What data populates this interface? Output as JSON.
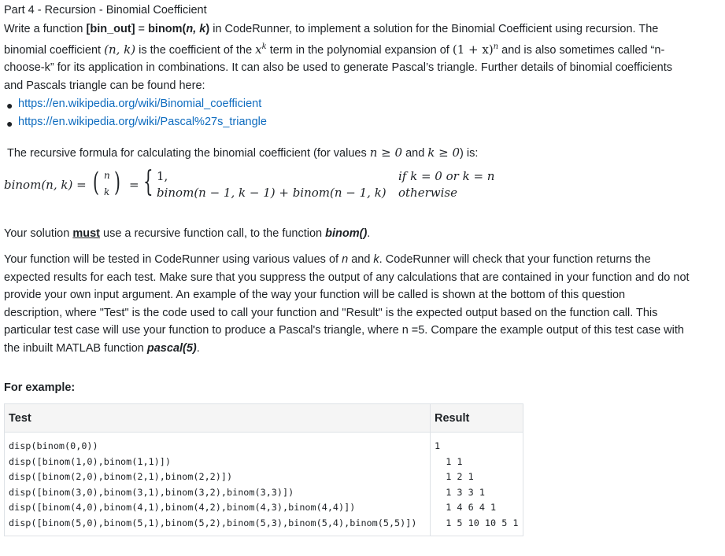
{
  "heading": "Part 4 - Recursion - Binomial Coefficient",
  "intro": {
    "t1": "Write a function ",
    "b1": "[bin_out]",
    "t2": " = ",
    "b2": "binom(",
    "b2i": "n, k",
    "b2e": ")",
    "t3": " in CodeRunner, to implement a solution for the Binomial Coefficient using recursion.  The",
    "line2a": "binomial coefficient ",
    "m_nk": "(n, k)",
    "line2b": " is the coefficient of the ",
    "m_xk": "x",
    "m_xk_sup": "k",
    "line2c": " term in the polynomial expansion of ",
    "m_poly": "(1 + x)",
    "m_poly_sup": "n",
    "line2d": " and is also sometimes called “n-",
    "line3": "choose-k” for its application in combinations.  It can also be used to generate Pascal’s triangle.  Further details of binomial coefficients",
    "line4": "and Pascals triangle can be found here:"
  },
  "links": [
    "https://en.wikipedia.org/wiki/Binomial_coefficient",
    "https://en.wikipedia.org/wiki/Pascal%27s_triangle"
  ],
  "formula_intro": {
    "a": "The recursive formula for calculating the binomial coefficient (for values ",
    "m1": "n ≥ 0",
    "b": " and ",
    "m2": "k ≥ 0",
    "c": ") is:"
  },
  "formula": {
    "lhs": "binom(n, k) =",
    "binom_n": "n",
    "binom_k": "k",
    "eq": "=",
    "case1": "1,",
    "cond1": "if k = 0 or k = n",
    "case2": "binom(n − 1, k − 1) + binom(n − 1, k)",
    "cond2": "otherwise"
  },
  "must_para": {
    "a": "Your solution ",
    "must": "must",
    "b": " use a recursive function call, to the function ",
    "fn": "binom()",
    "c": "."
  },
  "tested_para": {
    "l1a": "Your function will be tested in CodeRunner using various values of ",
    "l1n": "n",
    "l1b": " and ",
    "l1k": "k",
    "l1c": ". CodeRunner will check that your function returns the",
    "l2": "expected results for each test.  Make sure that you suppress the output of any calculations that are contained in your function and do not",
    "l3": "provide your own input argument.  An example of the way your function will be called is shown at the bottom of this question",
    "l4": "description, where \"Test\" is the code used to call your function and \"Result\" is the expected output based on the function call.  This",
    "l5": "particular test case will use your function to produce a Pascal's triangle, where n =5.  Compare the example output of this test case with",
    "l6a": "the inbuilt MATLAB function ",
    "l6fn": "pascal(5)",
    "l6b": "."
  },
  "example_label": "For example:",
  "table": {
    "headers": [
      "Test",
      "Result"
    ],
    "test_lines": [
      "disp(binom(0,0))",
      "disp([binom(1,0),binom(1,1)])",
      "disp([binom(2,0),binom(2,1),binom(2,2)])",
      "disp([binom(3,0),binom(3,1),binom(3,2),binom(3,3)])",
      "disp([binom(4,0),binom(4,1),binom(4,2),binom(4,3),binom(4,4)])",
      "disp([binom(5,0),binom(5,1),binom(5,2),binom(5,3),binom(5,4),binom(5,5)])"
    ],
    "result_lines": [
      "1",
      "  1 1",
      "  1 2 1",
      "  1 3 3 1",
      "  1 4 6 4 1",
      "  1 5 10 10 5 1"
    ]
  }
}
